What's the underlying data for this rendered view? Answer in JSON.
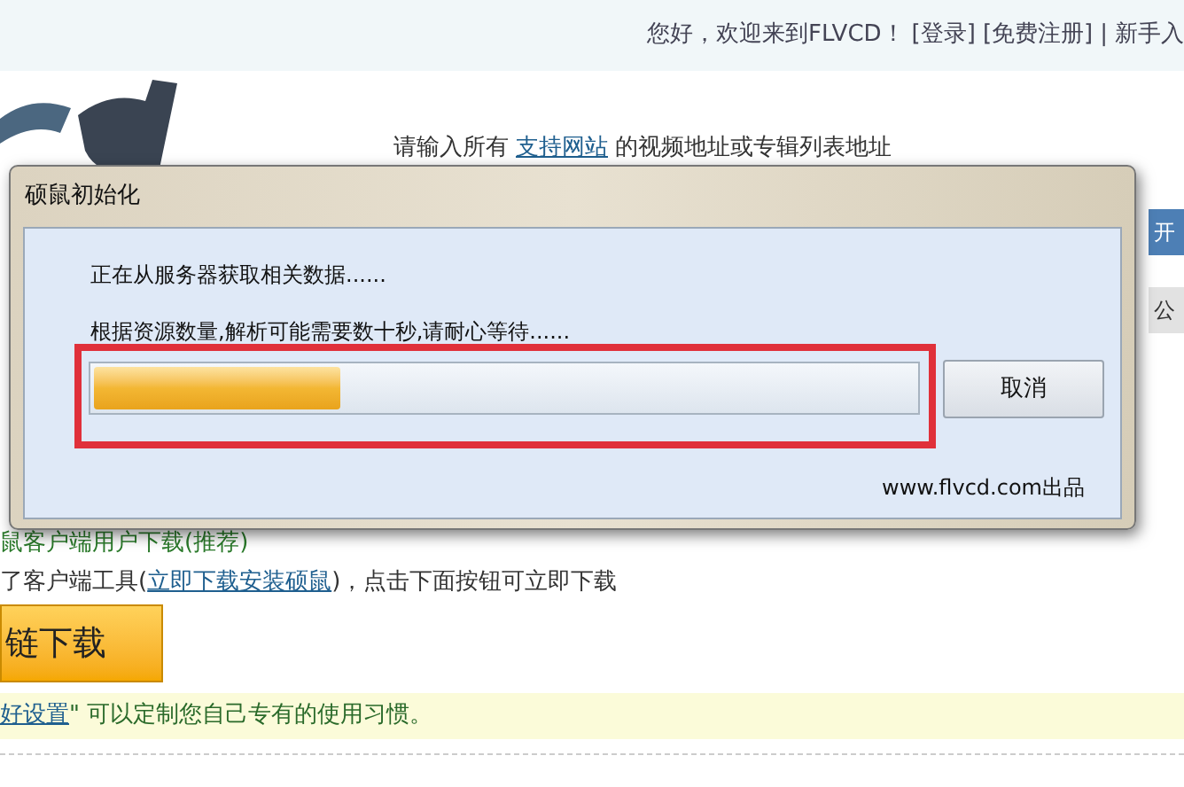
{
  "top_bar": {
    "greeting": "您好，欢迎来到FLVCD！",
    "links": [
      "[登录]",
      "[免费注册]"
    ],
    "separator": "|",
    "cut_link": "新手入"
  },
  "prompt": {
    "before": "请输入所有",
    "link": "支持网站",
    "after": "的视频地址或专辑列表地址"
  },
  "side_buttons": [
    "开",
    "公"
  ],
  "dialog": {
    "title": "硕鼠初始化",
    "lines": [
      "正在从服务器获取相关数据......",
      "根据资源数量,解析可能需要数十秒,请耐心等待......"
    ],
    "progress": {
      "level": 0.3,
      "highlighted": true
    },
    "cancel": "取消",
    "credit": "www.flvcd.com出品"
  },
  "section_heading": "鼠客户端用户下载(推荐)",
  "client_line": {
    "before": "了客户端工具(",
    "link": "立即下载安装硕鼠",
    "after": ")，点击下面按钮可立即下载"
  },
  "download_button": "链下载",
  "tip": {
    "link": "好设置",
    "after": "\" 可以定制您自己专有的使用习惯。"
  }
}
